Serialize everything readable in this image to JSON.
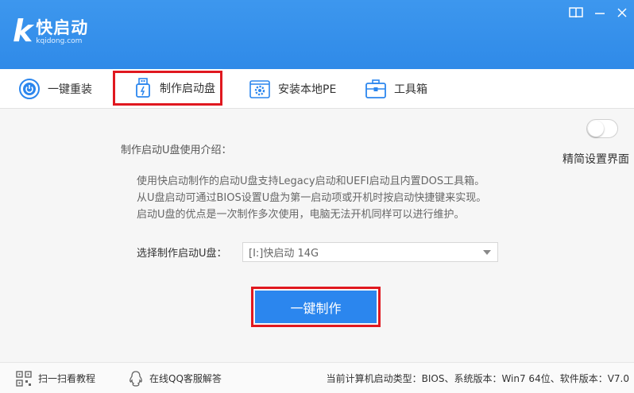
{
  "app": {
    "logo_letter": "k",
    "name": "快启动",
    "domain": "kqidong.com",
    "brand_color": "#2f8ae8"
  },
  "window_controls": [
    {
      "icon": "book-icon"
    },
    {
      "icon": "minimize-icon"
    },
    {
      "icon": "close-icon"
    }
  ],
  "tabs": [
    {
      "label": "一键重装",
      "icon": "power-icon"
    },
    {
      "label": "制作启动盘",
      "icon": "usb-drive-icon"
    },
    {
      "label": "安装本地PE",
      "icon": "gear-icon"
    },
    {
      "label": "工具箱",
      "icon": "toolbox-icon"
    }
  ],
  "settings": {
    "simple_mode_label": "精简设置界面",
    "simple_mode_enabled": false
  },
  "intro": {
    "title": "制作启动U盘使用介绍：",
    "lines": [
      "使用快启动制作的启动U盘支持Legacy启动和UEFI启动且内置DOS工具箱。",
      "从U盘启动可通过BIOS设置U盘为第一启动项或开机时按启动快捷键来实现。",
      "启动U盘的优点是一次制作多次使用，电脑无法开机同样可以进行维护。"
    ]
  },
  "selector": {
    "label": "选择制作启动U盘：",
    "selected": "[I:]快启动 14G"
  },
  "primary_button": {
    "label": "一键制作",
    "color": "#2b86ee"
  },
  "highlight_color": "#e0181f",
  "footer": {
    "scan_label": "扫一扫看教程",
    "qq_label": "在线QQ客服解答",
    "status": "当前计算机启动类型：BIOS、系统版本：Win7 64位、软件版本：V7.0"
  }
}
